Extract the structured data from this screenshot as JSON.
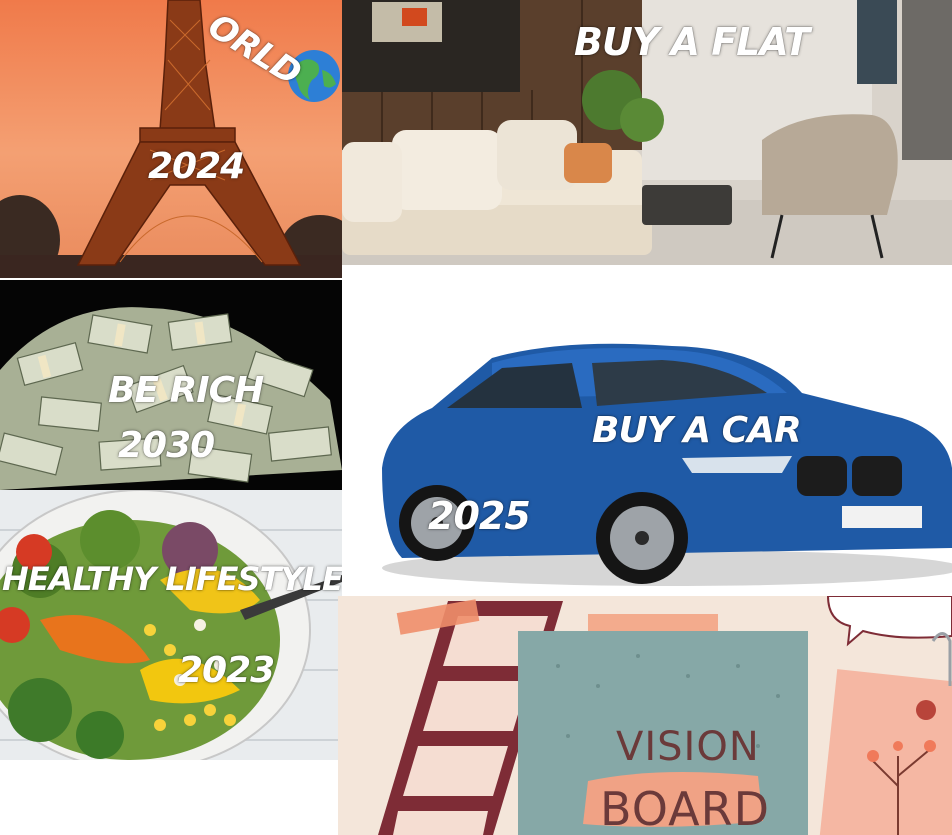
{
  "tiles": {
    "travel": {
      "caption_partial": "ORLD",
      "year": "2024"
    },
    "flat": {
      "caption": "BUY A FLAT"
    },
    "rich": {
      "caption": "BE RICH",
      "year": "2030"
    },
    "car": {
      "caption": "BUY A CAR",
      "year": "2025"
    },
    "health": {
      "caption": "HEALTHY LIFESTYLE",
      "year": "2023"
    },
    "vision": {
      "line1": "VISION",
      "line2": "BOARD"
    }
  }
}
